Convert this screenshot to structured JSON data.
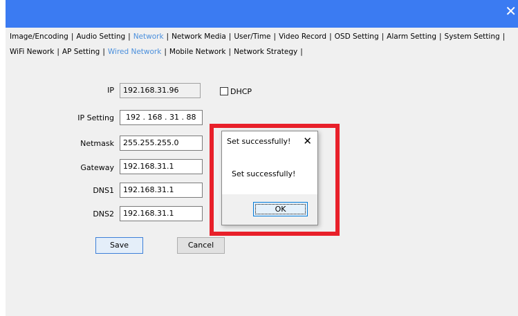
{
  "window": {
    "close_glyph": "✕",
    "colors": {
      "titlebar": "#3b7bf2",
      "panel": "#f0f0f0",
      "active_tab": "#4a8fdc",
      "highlight": "#e8202a"
    }
  },
  "tabs_main": [
    {
      "label": "Image/Encoding",
      "active": false
    },
    {
      "label": "Audio Setting",
      "active": false
    },
    {
      "label": "Network",
      "active": true
    },
    {
      "label": "Network Media",
      "active": false
    },
    {
      "label": "User/Time",
      "active": false
    },
    {
      "label": "Video Record",
      "active": false
    },
    {
      "label": "OSD Setting",
      "active": false
    },
    {
      "label": "Alarm Setting",
      "active": false
    },
    {
      "label": "System Setting",
      "active": false
    }
  ],
  "tabs_sub": [
    {
      "label": "WiFi Nework",
      "active": false
    },
    {
      "label": "AP Setting",
      "active": false
    },
    {
      "label": "Wired Network",
      "active": true
    },
    {
      "label": "Mobile Network",
      "active": false
    },
    {
      "label": "Network Strategy",
      "active": false
    }
  ],
  "form": {
    "ip": {
      "label": "IP",
      "value": "192.168.31.96"
    },
    "ip_setting": {
      "label": "IP Setting",
      "value": "192 . 168 . 31 . 88"
    },
    "netmask": {
      "label": "Netmask",
      "value": "255.255.255.0"
    },
    "gateway": {
      "label": "Gateway",
      "value": "192.168.31.1"
    },
    "dns1": {
      "label": "DNS1",
      "value": "192.168.31.1"
    },
    "dns2": {
      "label": "DNS2",
      "value": "192.168.31.1"
    },
    "dhcp": {
      "label": "DHCP",
      "checked": false
    },
    "save_label": "Save",
    "cancel_label": "Cancel"
  },
  "dialog": {
    "title": "Set successfully!",
    "close_glyph": "✕",
    "message": "Set successfully!",
    "ok_label": "OK"
  }
}
